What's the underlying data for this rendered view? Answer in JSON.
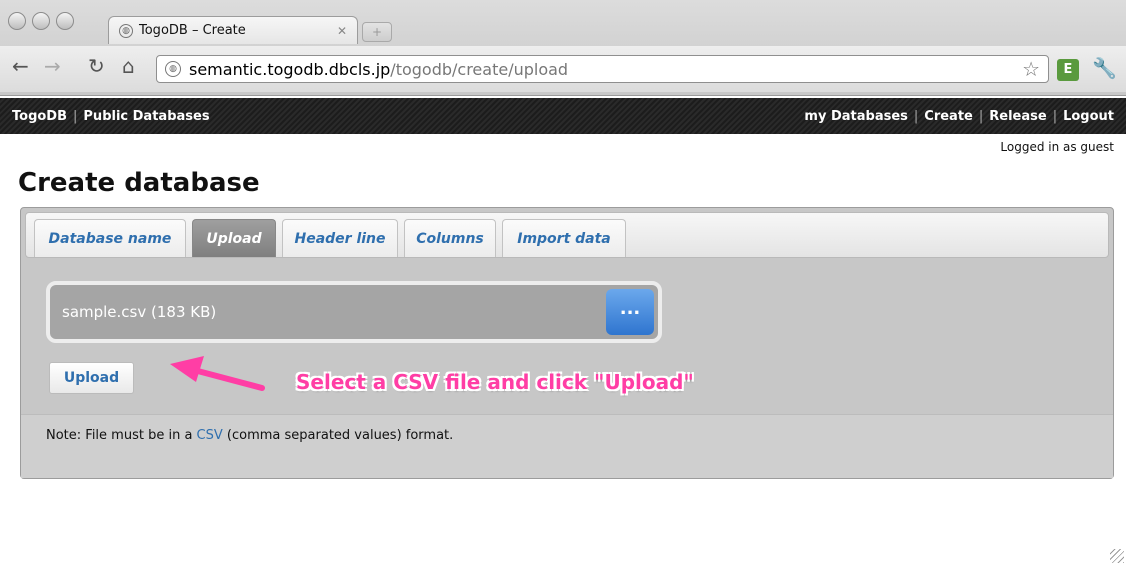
{
  "browser": {
    "tab_title": "TogoDB – Create",
    "url_host": "semantic.togodb.dbcls.jp",
    "url_path": "/togodb/create/upload"
  },
  "site": {
    "brand": "TogoDB",
    "public_databases": "Public Databases",
    "nav": [
      "my Databases",
      "Create",
      "Release",
      "Logout"
    ],
    "logged_in": "Logged in as guest"
  },
  "page": {
    "title": "Create database",
    "tabs": [
      {
        "label": "Database name",
        "active": false
      },
      {
        "label": "Upload",
        "active": true
      },
      {
        "label": "Header line",
        "active": false
      },
      {
        "label": "Columns",
        "active": false
      },
      {
        "label": "Import data",
        "active": false
      }
    ],
    "file_info": "sample.csv (183 KB)",
    "browse_label": "...",
    "upload_label": "Upload",
    "callout": "Select a CSV file and click \"Upload\"",
    "note_prefix": "Note: File must be in a ",
    "note_link": "CSV",
    "note_suffix": " (comma separated values) format."
  },
  "icons": {
    "back": "back-arrow-icon",
    "forward": "forward-arrow-icon",
    "reload": "reload-icon",
    "home": "home-icon",
    "star": "bookmark-star-icon",
    "evernote": "evernote-icon",
    "wrench": "wrench-icon"
  },
  "colors": {
    "accent": "#2f6fae",
    "callout": "#ff3ea5",
    "browse": "#2f75cf"
  }
}
